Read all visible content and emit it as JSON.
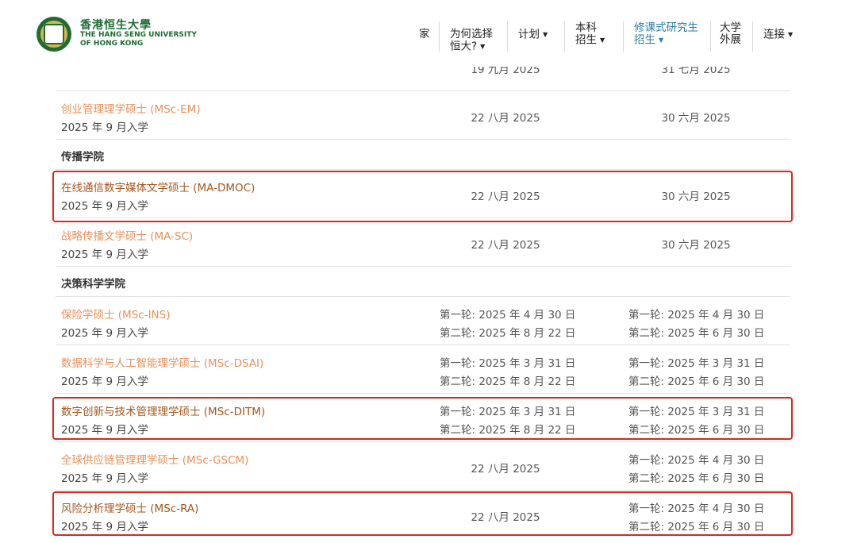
{
  "header": {
    "brand_cn": "香港恒生大學",
    "brand_en_line1": "THE HANG SENG UNIVERSITY",
    "brand_en_line2": "OF HONG KONG",
    "nav": {
      "home": "家",
      "why_l1": "为何选择",
      "why_l2": "恒大?",
      "plan": "计划",
      "ug_l1": "本科",
      "ug_l2": "招生",
      "pg_l1": "修课式研究生",
      "pg_l2": "招生",
      "ext_l1": "大学",
      "ext_l2": "外展",
      "connect": "连接"
    },
    "colors": {
      "brand_green": "#1e6b34",
      "nav_active": "#2a7ea0"
    }
  },
  "table": {
    "partial_top": {
      "col2": "19 九月 2025",
      "col3": "31 七月 2025"
    },
    "rows": [
      {
        "name": "创业管理理学硕士 (MSc-EM)",
        "intake": "2025 年 9 月入学",
        "col2": "22 八月 2025",
        "col3": "30 六月 2025"
      },
      {
        "section": "传播学院"
      },
      {
        "name": "在线通信数字媒体文学硕士 (MA-DMOC)",
        "intake": "2025 年 9 月入学",
        "col2": "22 八月 2025",
        "col3": "30 六月 2025"
      },
      {
        "name": "战略传播文学硕士 (MA-SC)",
        "intake": "2025 年 9 月入学",
        "col2": "22 八月 2025",
        "col3": "30 六月 2025"
      },
      {
        "section": "决策科学学院"
      },
      {
        "name": "保险学硕士 (MSc-INS)",
        "intake": "2025 年 9 月入学",
        "col2_a": "第一轮: 2025 年 4 月 30 日",
        "col2_b": "第二轮: 2025 年 8 月 22 日",
        "col3_a": "第一轮: 2025 年 4 月 30 日",
        "col3_b": "第二轮: 2025 年 6 月 30 日"
      },
      {
        "name": "数据科学与人工智能理学硕士 (MSc-DSAI)",
        "intake": "2025 年 9 月入学",
        "col2_a": "第一轮: 2025 年 3 月 31 日",
        "col2_b": "第二轮: 2025 年 8 月 22 日",
        "col3_a": "第一轮: 2025 年 3 月 31 日",
        "col3_b": "第二轮: 2025 年 6 月 30 日"
      },
      {
        "name": "数字创新与技术管理理学硕士 (MSc-DITM)",
        "intake": "2025 年 9 月入学",
        "col2_a": "第一轮: 2025 年 3 月 31 日",
        "col2_b": "第二轮: 2025 年 8 月 22 日",
        "col3_a": "第一轮: 2025 年 3 月 31 日",
        "col3_b": "第二轮: 2025 年 6 月 30 日"
      },
      {
        "name": "全球供应链管理理学硕士 (MSc-GSCM)",
        "intake": "2025 年 9 月入学",
        "col2": "22 八月 2025",
        "col3_a": "第一轮: 2025 年 4 月 30 日",
        "col3_b": "第二轮: 2025 年 6 月 30 日"
      },
      {
        "name": "风险分析理学硕士 (MSc-RA)",
        "intake": "2025 年 9 月入学",
        "col2": "22 八月 2025",
        "col3_a": "第一轮: 2025 年 4 月 30 日",
        "col3_b": "第二轮: 2025 年 6 月 30 日"
      }
    ],
    "colors": {
      "link": "#e8915a",
      "link_highlighted": "#a4561e",
      "highlight_box": "#e3241b"
    }
  }
}
